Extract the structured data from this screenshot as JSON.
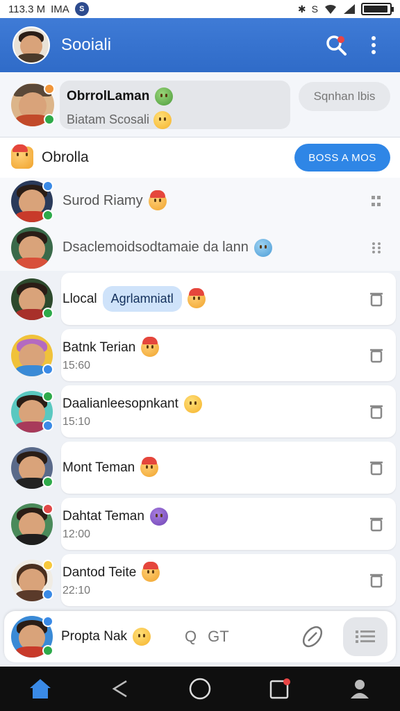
{
  "status_bar": {
    "time": "113.3 M",
    "carrier": "IMA",
    "signal_text": "S"
  },
  "app_bar": {
    "title": "Sooiali"
  },
  "top_conversation": {
    "name": "ObrrolLaman",
    "subtitle": "Biatam Scosali",
    "action_label": "Sqnhan lbis"
  },
  "section": {
    "label": "Obrolla",
    "button_label": "BOSS A MOS"
  },
  "conversations": [
    {
      "name": "Surod Riamy",
      "time": ""
    },
    {
      "name": "Dsaclemoidsodtamaie da lann",
      "time": ""
    },
    {
      "name": "Llocal",
      "chip": "Agrlamniatl",
      "time": ""
    },
    {
      "name": "Batnk Terian",
      "time": "15:60"
    },
    {
      "name": "Daalianleesopnkant",
      "time": "15:10"
    },
    {
      "name": "Mont Teman",
      "time": ""
    },
    {
      "name": "Dahtat Teman",
      "time": "12:00"
    },
    {
      "name": "Dantod Teite",
      "time": "22:10"
    }
  ],
  "composer": {
    "name": "Propta Nak",
    "tool_q": "Q",
    "tool_gt": "GT"
  },
  "colors": {
    "primary": "#2f6bc8",
    "accent_blue": "#2f86e6",
    "online": "#2eaa4a"
  },
  "icons": [
    "search-icon",
    "more-vert-icon",
    "home-icon",
    "share-icon",
    "circle-icon",
    "notification-icon",
    "profile-icon"
  ]
}
